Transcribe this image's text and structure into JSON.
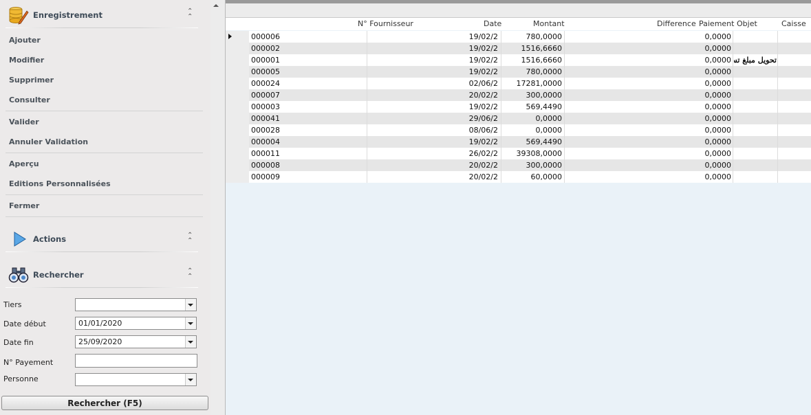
{
  "panel": {
    "group_enregistrement": "Enregistrement",
    "menu": [
      "Ajouter",
      "Modifier",
      "Supprimer",
      "Consulter",
      "Valider",
      "Annuler Validation",
      "Aperçu",
      "Editions Personnalisées",
      "Fermer"
    ],
    "group_actions": "Actions",
    "group_rechercher": "Rechercher",
    "chevron": "«"
  },
  "search": {
    "labels": {
      "tiers": "Tiers",
      "date_debut": "Date début",
      "date_fin": "Date fin",
      "payement": "N° Payement",
      "personne": "Personne"
    },
    "values": {
      "tiers": "",
      "date_debut": "01/01/2020",
      "date_fin": "25/09/2020",
      "payement": "",
      "personne": ""
    },
    "button": "Rechercher (F5)"
  },
  "grid": {
    "columns": [
      "N° Fournisseur",
      "Date",
      "Montant",
      "Difference",
      "Paiement",
      "Objet",
      "Caisse"
    ],
    "rows": [
      {
        "no": "000006",
        "date": "19/02/2",
        "montant": "780,0000",
        "paiement": "0,0000",
        "objet": ""
      },
      {
        "no": "000002",
        "date": "19/02/2",
        "montant": "1516,6660",
        "paiement": "0,0000",
        "objet": ""
      },
      {
        "no": "000001",
        "date": "19/02/2",
        "montant": "1516,6660",
        "paiement": "0,0000",
        "objet": "تحويل مبلغ تسب"
      },
      {
        "no": "000005",
        "date": "19/02/2",
        "montant": "780,0000",
        "paiement": "0,0000",
        "objet": ""
      },
      {
        "no": "000024",
        "date": "02/06/2",
        "montant": "17281,0000",
        "paiement": "0,0000",
        "objet": ""
      },
      {
        "no": "000007",
        "date": "20/02/2",
        "montant": "300,0000",
        "paiement": "0,0000",
        "objet": ""
      },
      {
        "no": "000003",
        "date": "19/02/2",
        "montant": "569,4490",
        "paiement": "0,0000",
        "objet": ""
      },
      {
        "no": "000041",
        "date": "29/06/2",
        "montant": "0,0000",
        "paiement": "0,0000",
        "objet": ""
      },
      {
        "no": "000028",
        "date": "08/06/2",
        "montant": "0,0000",
        "paiement": "0,0000",
        "objet": ""
      },
      {
        "no": "000004",
        "date": "19/02/2",
        "montant": "569,4490",
        "paiement": "0,0000",
        "objet": ""
      },
      {
        "no": "000011",
        "date": "26/02/2",
        "montant": "39308,0000",
        "paiement": "0,0000",
        "objet": ""
      },
      {
        "no": "000008",
        "date": "20/02/2",
        "montant": "300,0000",
        "paiement": "0,0000",
        "objet": ""
      },
      {
        "no": "000009",
        "date": "20/02/2",
        "montant": "60,0000",
        "paiement": "0,0000",
        "objet": ""
      }
    ]
  }
}
